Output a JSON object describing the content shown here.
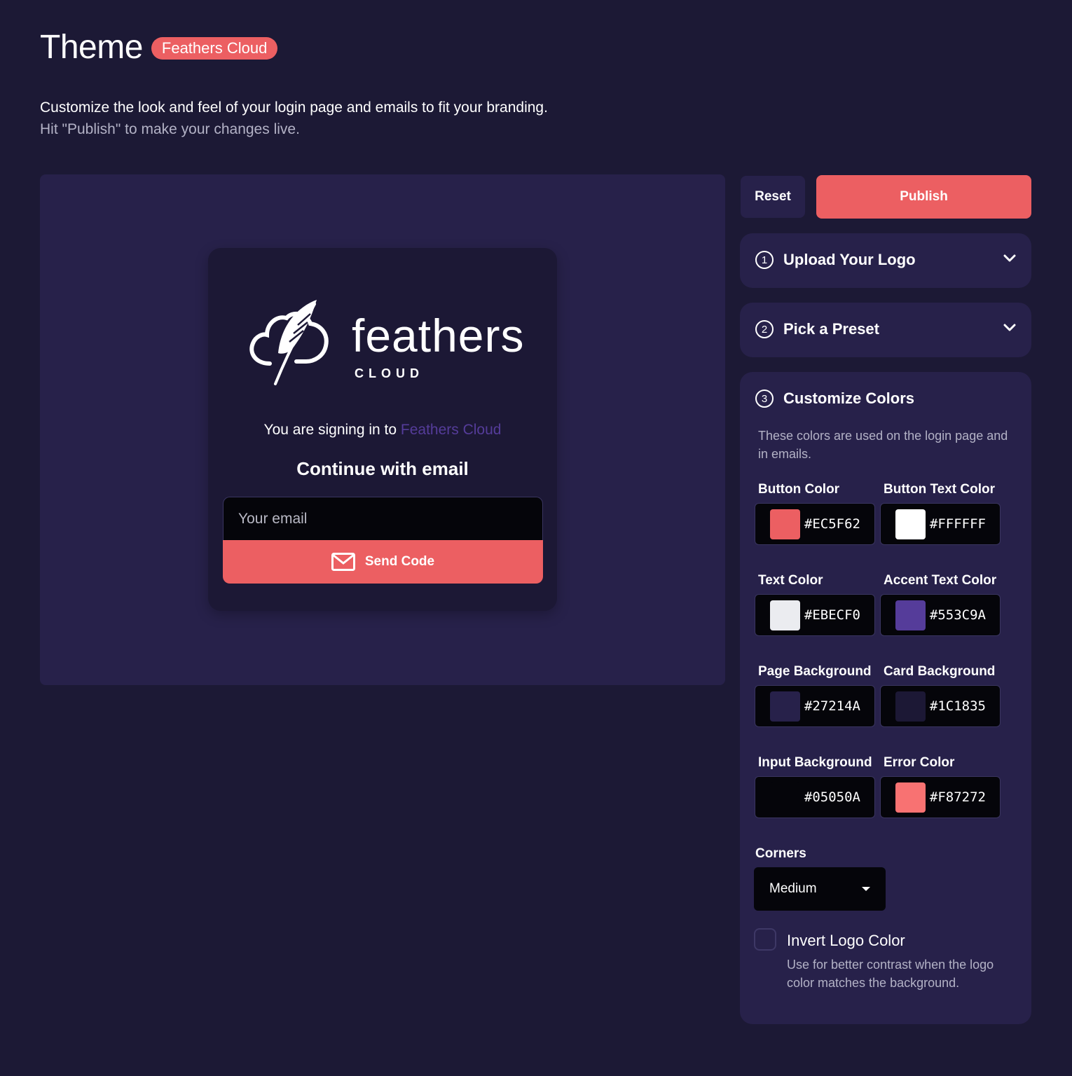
{
  "header": {
    "title": "Theme",
    "badge": "Feathers Cloud",
    "description_line1": "Customize the look and feel of your login page and emails to fit your branding.",
    "description_line2": "Hit \"Publish\" to make your changes live."
  },
  "preview": {
    "logo_word": "feathers",
    "logo_sub": "CLOUD",
    "signing_prefix": "You are signing in to ",
    "signing_app": "Feathers Cloud",
    "continue_heading": "Continue with email",
    "email_placeholder": "Your email",
    "send_button": "Send Code"
  },
  "actions": {
    "reset": "Reset",
    "publish": "Publish"
  },
  "steps": [
    {
      "number": "1",
      "title": "Upload Your Logo"
    },
    {
      "number": "2",
      "title": "Pick a Preset"
    },
    {
      "number": "3",
      "title": "Customize Colors"
    }
  ],
  "colors_panel": {
    "description": "These colors are used on the login page and in emails.",
    "fields": [
      {
        "label": "Button Color",
        "hex": "#EC5F62",
        "color": "#EC5F62"
      },
      {
        "label": "Button Text Color",
        "hex": "#FFFFFF",
        "color": "#FFFFFF"
      },
      {
        "label": "Text Color",
        "hex": "#EBECF0",
        "color": "#EBECF0"
      },
      {
        "label": "Accent Text Color",
        "hex": "#553C9A",
        "color": "#553C9A"
      },
      {
        "label": "Page Background",
        "hex": "#27214A",
        "color": "#27214A"
      },
      {
        "label": "Card Background",
        "hex": "#1C1835",
        "color": "#1C1835"
      },
      {
        "label": "Input Background",
        "hex": "#05050A",
        "color": "#05050A"
      },
      {
        "label": "Error Color",
        "hex": "#F87272",
        "color": "#F87272"
      }
    ],
    "corners_label": "Corners",
    "corners_value": "Medium",
    "invert_label": "Invert Logo Color",
    "invert_description": "Use for better contrast when the logo color matches the background."
  },
  "icons": [
    "mail-icon",
    "chevron-down-icon",
    "feather-cloud-logo-icon",
    "dropdown-caret-icon"
  ]
}
